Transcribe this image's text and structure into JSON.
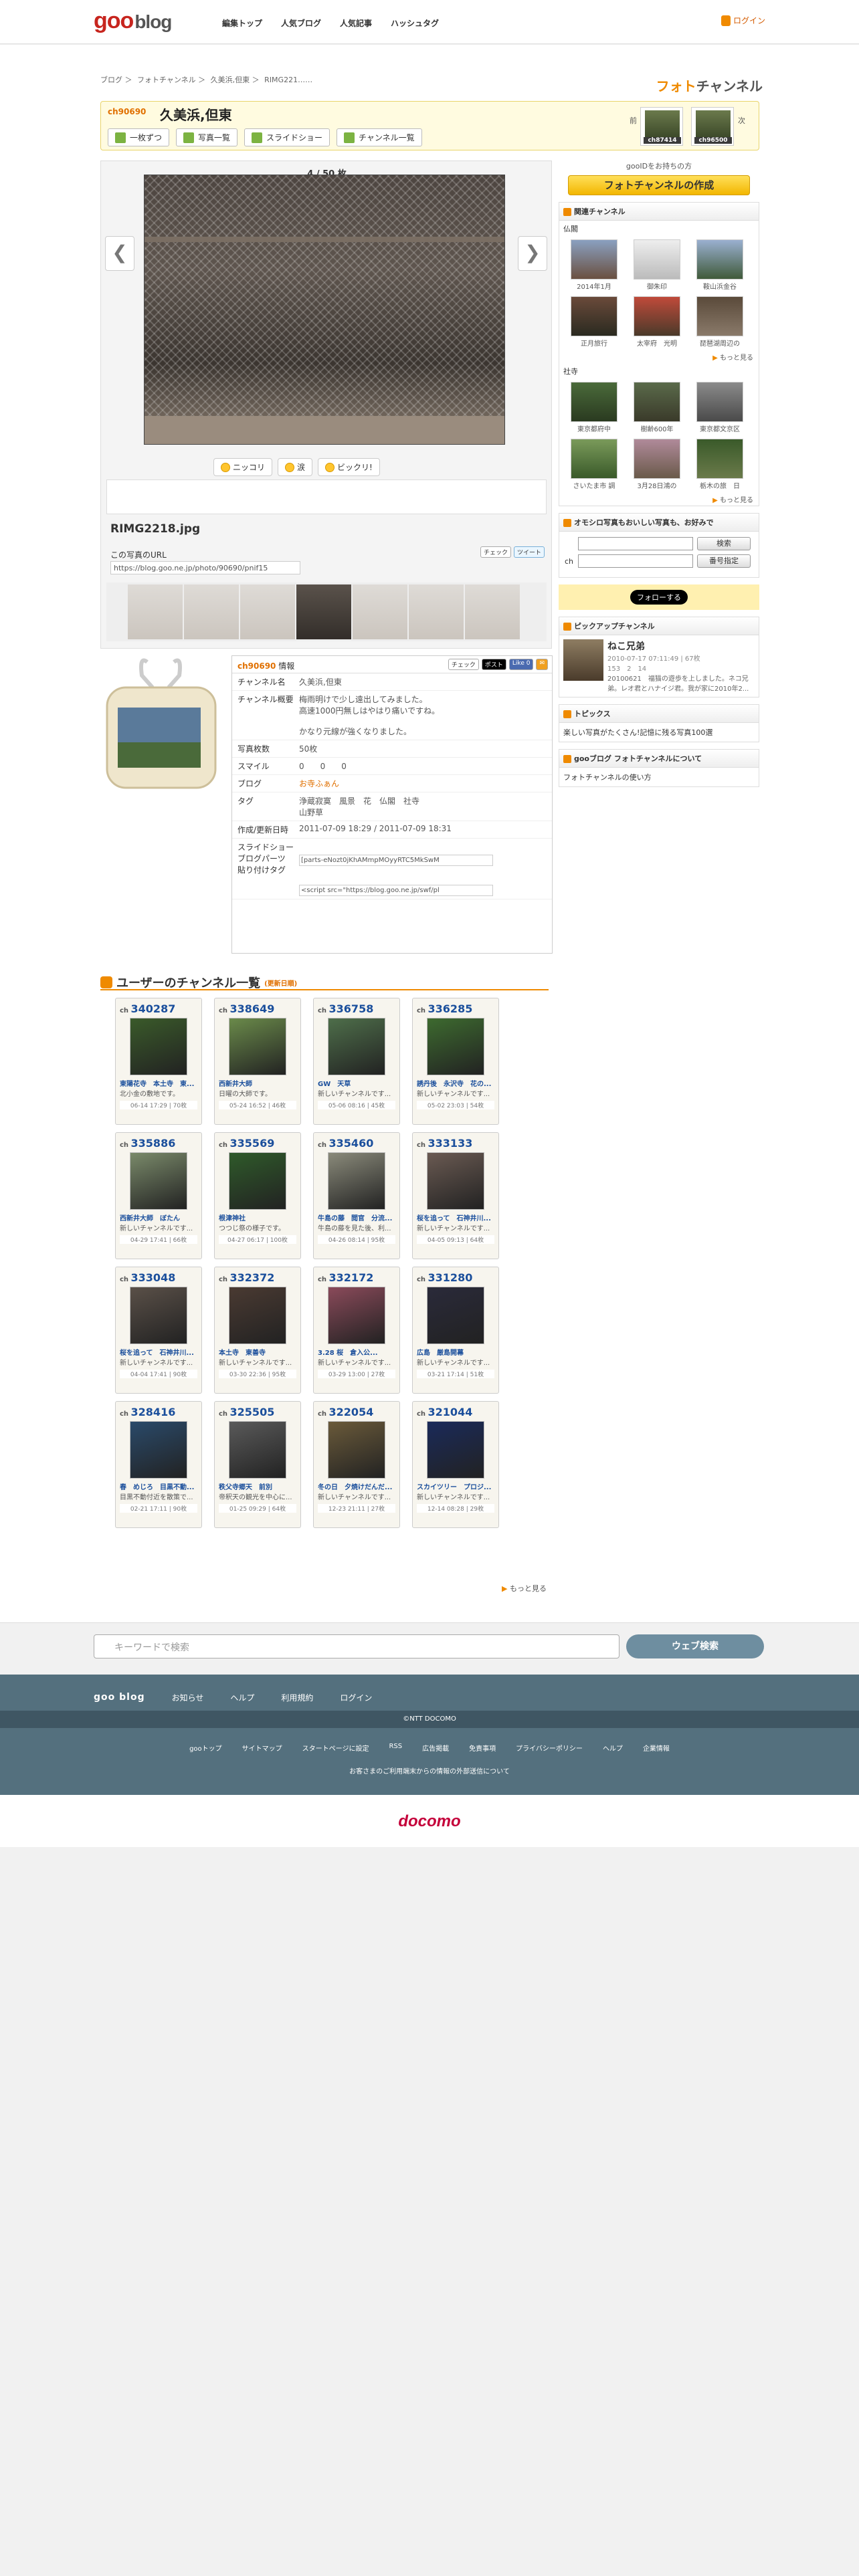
{
  "topbar": {
    "logo_a": "goo",
    "logo_b": "blog",
    "nav": [
      "編集トップ",
      "人気ブログ",
      "人気記事",
      "ハッシュタグ"
    ],
    "login": "ログイン"
  },
  "breadcrumb": [
    "ブログ ＞",
    "フォトチャンネル ＞",
    "久美浜,但東 ＞",
    "RIMG221……"
  ],
  "photo_logo": {
    "a": "フォト",
    "b": "チャンネル"
  },
  "header": {
    "ch_no": "ch90690",
    "title": "久美浜,但東",
    "buttons": [
      "一枚ずつ",
      "写真一覧",
      "スライドショー",
      "チャンネル一覧"
    ],
    "prev": "前",
    "next": "次",
    "prev_id": "ch87414",
    "next_id": "ch96500"
  },
  "photo": {
    "count": "4 / 50 枚",
    "prev": "❮",
    "next": "❯",
    "reactions": [
      "ニッコリ",
      "涙",
      "ビックリ!"
    ],
    "filename": "RIMG2218.jpg",
    "url_label": "この写真のURL",
    "url": "https://blog.goo.ne.jp/photo/90690/pnif15",
    "share": [
      "チェック",
      "ツイート"
    ]
  },
  "right": {
    "note": "gooIDをお持ちの方",
    "create": "フォトチャンネルの作成",
    "related_title": "関連チャンネル",
    "cat1": "仏閣",
    "cat1_items": [
      "2014年1月",
      "御朱印",
      "鞍山浜金谷",
      "正月旅行",
      "太宰府　光明",
      "琵琶湖周辺の"
    ],
    "cat2": "社寺",
    "cat2_items": [
      "東京都府中",
      "樹齢600年",
      "東京都文京区",
      "さいたま市 調",
      "3月28日鴻の",
      "栃木の旅　日"
    ],
    "more": "もっと見る",
    "shop_title": "オモシロ写真もおいしい写真も、お好みで",
    "shop_btn1": "検索",
    "shop_btn2": "番号指定",
    "shop_ch": "ch",
    "follow": "フォローする",
    "pickup_title": "ピックアップチャンネル",
    "pickup_name": "ねこ兄弟",
    "pickup_date": "2010-07-17 07:11:49 | 67枚",
    "pickup_stats": "153　2　14",
    "pickup_desc": "20100621　福猫の遊歩を上しました。ネコ兄弟。レオ君とハナイジ君。我が家に2010年2...",
    "topics_title": "トピックス",
    "topics_item": "楽しい写真がたくさん!記憶に残る写真100選",
    "about_title": "gooブログ フォトチャンネルについて",
    "about_item": "フォトチャンネルの使い方"
  },
  "info": {
    "ch": "ch90690",
    "title_suffix": "情報",
    "name_k": "チャンネル名",
    "name_v": "久美浜,但東",
    "desc_k": "チャンネル概要",
    "desc_v": "梅雨明けで少し遠出してみました。\n高速1000円無しはやはり痛いですね。\n\nかなり元線が強くなりました。",
    "count_k": "写真枚数",
    "count_v": "50枚",
    "smile_k": "スマイル",
    "smile_v": "0　　0　　0",
    "blog_k": "ブログ",
    "blog_v": "お寺ふぁん",
    "tag_k": "タグ",
    "tag_v": "浄蔵寂寞　風景　花　仏閣　社寺\n山野草",
    "date_k": "作成/更新日時",
    "date_v": "2011-07-09 18:29 / 2011-07-09 18:31",
    "slide_k": "スライドショー\nブログパーツ\n貼り付けタグ",
    "slide_v1": "[parts-eNozt0jKhAMmpMOyyRTC5MkSwM",
    "slide_v2": "<script src=\"https://blog.goo.ne.jp/swf/pl",
    "like": "Like 0",
    "post": "ポスト",
    "check": "チェック"
  },
  "list": {
    "title": "ユーザーのチャンネル一覧",
    "sub": "(更新日順)",
    "more": "もっと見る",
    "cards": [
      {
        "no": "340287",
        "t": "東陽花寺　本土寺　東...",
        "d": "北小金の敷地です。",
        "m": "06-14 17:29 | 70枚",
        "c": "#3a5a2a"
      },
      {
        "no": "338649",
        "t": "西新井大師",
        "d": "日曜の大師です。",
        "m": "05-24 16:52 | 46枚",
        "c": "#6a8a4a"
      },
      {
        "no": "336758",
        "t": "GW　天草",
        "d": "新しいチャンネルです...",
        "m": "05-06 08:16 | 45枚",
        "c": "#4e6e4a"
      },
      {
        "no": "336285",
        "t": "誘丹後　永沢寺　花の...",
        "d": "新しいチャンネルです...",
        "m": "05-02 23:03 | 54枚",
        "c": "#3d6a2f"
      },
      {
        "no": "335886",
        "t": "西新井大師　ぼたん",
        "d": "新しいチャンネルです...",
        "m": "04-29 17:41 | 66枚",
        "c": "#7a8a6a"
      },
      {
        "no": "335569",
        "t": "根津神社",
        "d": "つつじ祭の様子です。",
        "m": "04-27 06:17 | 100枚",
        "c": "#2f5a2a"
      },
      {
        "no": "335460",
        "t": "牛島の藤　閲官　分流...",
        "d": "牛島の藤を見た後、利...",
        "m": "04-26 08:14 | 95枚",
        "c": "#8a8a7a"
      },
      {
        "no": "333133",
        "t": "桜を追って　石神井川...",
        "d": "新しいチャンネルです...",
        "m": "04-05 09:13 | 64枚",
        "c": "#6a5a52"
      },
      {
        "no": "333048",
        "t": "桜を追って　石神井川...",
        "d": "新しいチャンネルです...",
        "m": "04-04 17:41 | 90枚",
        "c": "#5a5048"
      },
      {
        "no": "332372",
        "t": "本土寺　東善寺",
        "d": "新しいチャンネルです...",
        "m": "03-30 22:36 | 95枚",
        "c": "#4a3a32"
      },
      {
        "no": "332172",
        "t": "3.28 桜　倉入公...",
        "d": "新しいチャンネルです...",
        "m": "03-29 13:00 | 27枚",
        "c": "#8a4a5a"
      },
      {
        "no": "331280",
        "t": "広島　厳島開幕",
        "d": "新しいチャンネルです...",
        "m": "03-21 17:14 | 51枚",
        "c": "#2a2a3a"
      },
      {
        "no": "328416",
        "t": "春　めじろ　目黒不動...",
        "d": "目黒不動付近を散策で...",
        "m": "02-21 17:11 | 90枚",
        "c": "#2a4a6a"
      },
      {
        "no": "325505",
        "t": "秩父寺郷天　前別",
        "d": "帝釈天の観光を中心に...",
        "m": "01-25 09:29 | 64枚",
        "c": "#5a5a5a"
      },
      {
        "no": "322054",
        "t": "冬の日　夕焼けだんだ...",
        "d": "新しいチャンネルです...",
        "m": "12-23 21:11 | 27枚",
        "c": "#6a5a3a"
      },
      {
        "no": "321044",
        "t": "スカイツリー　プロジ...",
        "d": "新しいチャンネルです...",
        "m": "12-14 08:28 | 29枚",
        "c": "#1a2a5a"
      }
    ]
  },
  "search": {
    "placeholder": "キーワードで検索",
    "button": "ウェブ検索"
  },
  "footer": {
    "logo": "goo blog",
    "links1": [
      "お知らせ",
      "ヘルプ",
      "利用規約",
      "ログイン"
    ],
    "copy": "©NTT DOCOMO",
    "links2": [
      "gooトップ",
      "サイトマップ",
      "スタートページに設定",
      "RSS",
      "広告掲載",
      "免責事項",
      "プライバシーポリシー",
      "ヘルプ",
      "企業情報"
    ],
    "note": "お客さまのご利用端末からの情報の外部送信について",
    "docomo": "docomo"
  }
}
